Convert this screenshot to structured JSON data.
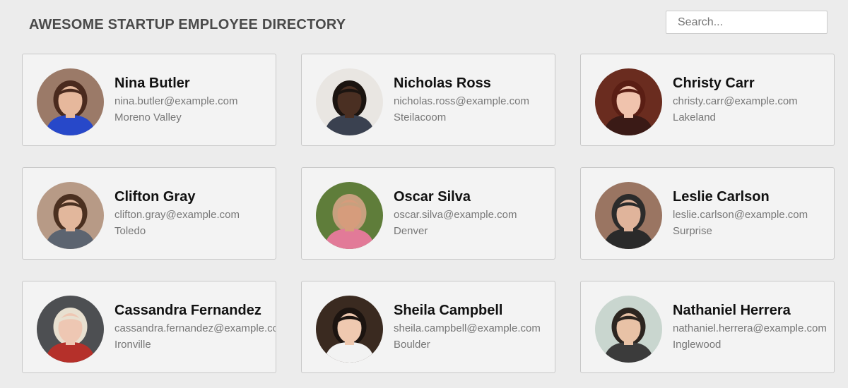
{
  "header": {
    "title": "AWESOME STARTUP EMPLOYEE DIRECTORY"
  },
  "search": {
    "placeholder": "Search..."
  },
  "employees": [
    {
      "name": "Nina Butler",
      "email": "nina.butler@example.com",
      "location": "Moreno Valley",
      "avatar_icon": "person-photo",
      "colors": {
        "bg": "#9b7a68",
        "hair": "#4a2a1e",
        "skin": "#e6b89c",
        "shirt": "#2748c9"
      }
    },
    {
      "name": "Nicholas Ross",
      "email": "nicholas.ross@example.com",
      "location": "Steilacoom",
      "avatar_icon": "person-photo",
      "colors": {
        "bg": "#e9e6e2",
        "hair": "#1b1410",
        "skin": "#4a2f22",
        "shirt": "#3a4150"
      }
    },
    {
      "name": "Christy Carr",
      "email": "christy.carr@example.com",
      "location": "Lakeland",
      "avatar_icon": "person-photo",
      "colors": {
        "bg": "#6a2c1f",
        "hair": "#5a1e14",
        "skin": "#f0c3ad",
        "shirt": "#3a1a16"
      }
    },
    {
      "name": "Clifton Gray",
      "email": "clifton.gray@example.com",
      "location": "Toledo",
      "avatar_icon": "person-photo",
      "colors": {
        "bg": "#b79a86",
        "hair": "#4b3020",
        "skin": "#e2b79c",
        "shirt": "#5c6470"
      }
    },
    {
      "name": "Oscar Silva",
      "email": "oscar.silva@example.com",
      "location": "Denver",
      "avatar_icon": "person-photo",
      "colors": {
        "bg": "#5f7d3a",
        "hair": "#c7a07e",
        "skin": "#d69c7c",
        "shirt": "#e27a98"
      }
    },
    {
      "name": "Leslie Carlson",
      "email": "leslie.carlson@example.com",
      "location": "Surprise",
      "avatar_icon": "person-photo",
      "colors": {
        "bg": "#9a7562",
        "hair": "#2b2b2b",
        "skin": "#e0b49b",
        "shirt": "#2a2a2a"
      }
    },
    {
      "name": "Cassandra Fernandez",
      "email": "cassandra.fernandez@example.com",
      "location": "Ironville",
      "avatar_icon": "person-photo",
      "colors": {
        "bg": "#4d4f52",
        "hair": "#e8e0d0",
        "skin": "#eec7b3",
        "shirt": "#b5302a"
      }
    },
    {
      "name": "Sheila Campbell",
      "email": "sheila.campbell@example.com",
      "location": "Boulder",
      "avatar_icon": "person-photo",
      "colors": {
        "bg": "#3a2a20",
        "hair": "#1c1410",
        "skin": "#efc9b0",
        "shirt": "#f2f2f2"
      }
    },
    {
      "name": "Nathaniel Herrera",
      "email": "nathaniel.herrera@example.com",
      "location": "Inglewood",
      "avatar_icon": "person-photo",
      "colors": {
        "bg": "#c9d6cf",
        "hair": "#2c2520",
        "skin": "#e8c2a6",
        "shirt": "#3b3b3b"
      }
    }
  ]
}
